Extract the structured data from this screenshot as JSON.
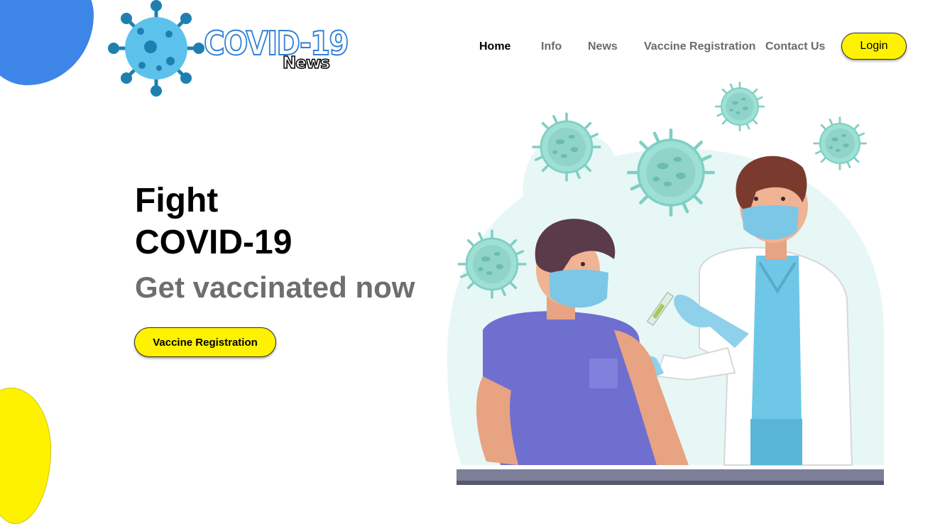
{
  "header": {
    "logo": {
      "title": "COVID-19",
      "subtitle": "News",
      "icon": "virus-icon"
    },
    "nav": [
      {
        "label": "Home",
        "active": true
      },
      {
        "label": "Info",
        "active": false
      },
      {
        "label": "News",
        "active": false
      },
      {
        "label": "Vaccine Registration",
        "active": false
      },
      {
        "label": "Contact Us",
        "active": false
      }
    ],
    "login_label": "Login"
  },
  "hero": {
    "line1": "Fight",
    "line2": "COVID-19",
    "subtitle": "Get vaccinated now",
    "cta_label": "Vaccine Registration"
  },
  "colors": {
    "accent_yellow": "#fff200",
    "blob_blue": "#3d85e6",
    "logo_blue": "#2f7fd6",
    "virus_teal": "#8fd8cf",
    "text_gray": "#6e6e6e"
  }
}
